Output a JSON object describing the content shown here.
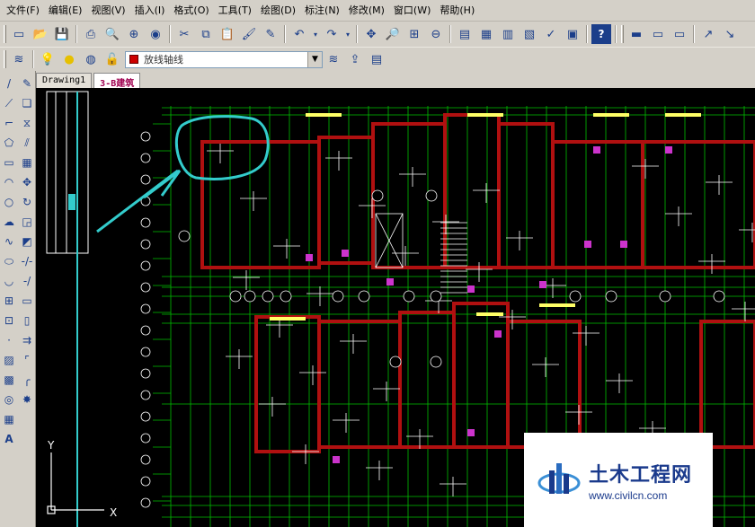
{
  "menubar": {
    "items": [
      "文件(F)",
      "编辑(E)",
      "视图(V)",
      "插入(I)",
      "格式(O)",
      "工具(T)",
      "绘图(D)",
      "标注(N)",
      "修改(M)",
      "窗口(W)",
      "帮助(H)"
    ]
  },
  "toolbar": {
    "layer_name": "放线轴线",
    "layer_color": "#cc0000"
  },
  "tabs": [
    "Drawing1",
    "3-B建筑"
  ],
  "active_tab": "3-B建筑",
  "ucs": {
    "y_label": "Y",
    "x_label": "X"
  },
  "watermark": {
    "title": "土木工程网",
    "url": "www.civilcn.com"
  },
  "colors": {
    "canvas_bg": "#000000",
    "wall_red": "#8b0000",
    "grid_green": "#00c000",
    "annotation_cyan": "#33cccc",
    "accent_magenta": "#cc33cc"
  }
}
